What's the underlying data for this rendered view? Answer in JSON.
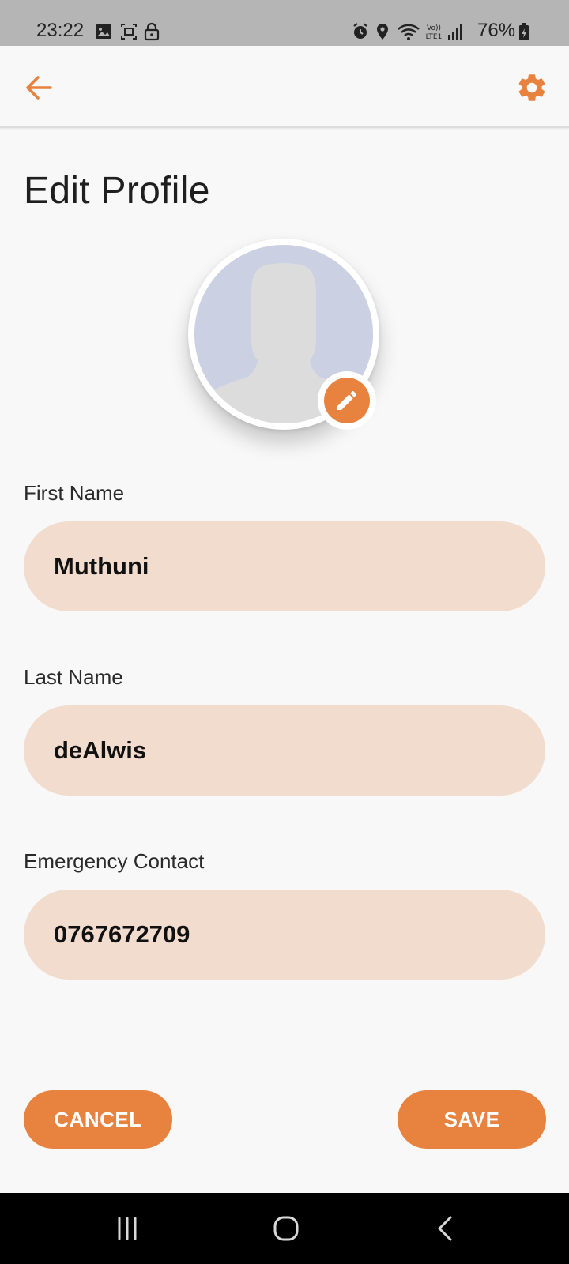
{
  "status_bar": {
    "time": "23:22",
    "battery": "76%",
    "left_icons": [
      "gallery-icon",
      "screenshot-icon",
      "lock-icon"
    ],
    "right_icons": [
      "alarm-icon",
      "location-icon",
      "wifi-icon",
      "volte-icon",
      "signal-icon",
      "battery-icon"
    ]
  },
  "app_bar": {
    "back_icon": "arrow-left-icon",
    "settings_icon": "gear-icon"
  },
  "title": "Edit Profile",
  "avatar": {
    "icon": "user-silhouette-icon",
    "edit_icon": "pencil-icon"
  },
  "fields": {
    "first_name": {
      "label": "First Name",
      "value": "Muthuni"
    },
    "last_name": {
      "label": "Last Name",
      "value": "deAlwis"
    },
    "emergency_contact": {
      "label": "Emergency Contact",
      "value": "0767672709"
    }
  },
  "buttons": {
    "cancel": "CANCEL",
    "save": "SAVE"
  },
  "nav_bar": {
    "icons": [
      "recent-apps-icon",
      "home-icon",
      "back-nav-icon"
    ]
  },
  "colors": {
    "accent": "#e8823f",
    "field_bg": "#f2dcce",
    "background": "#f8f8f8",
    "status_bar": "#b5b5b5"
  }
}
